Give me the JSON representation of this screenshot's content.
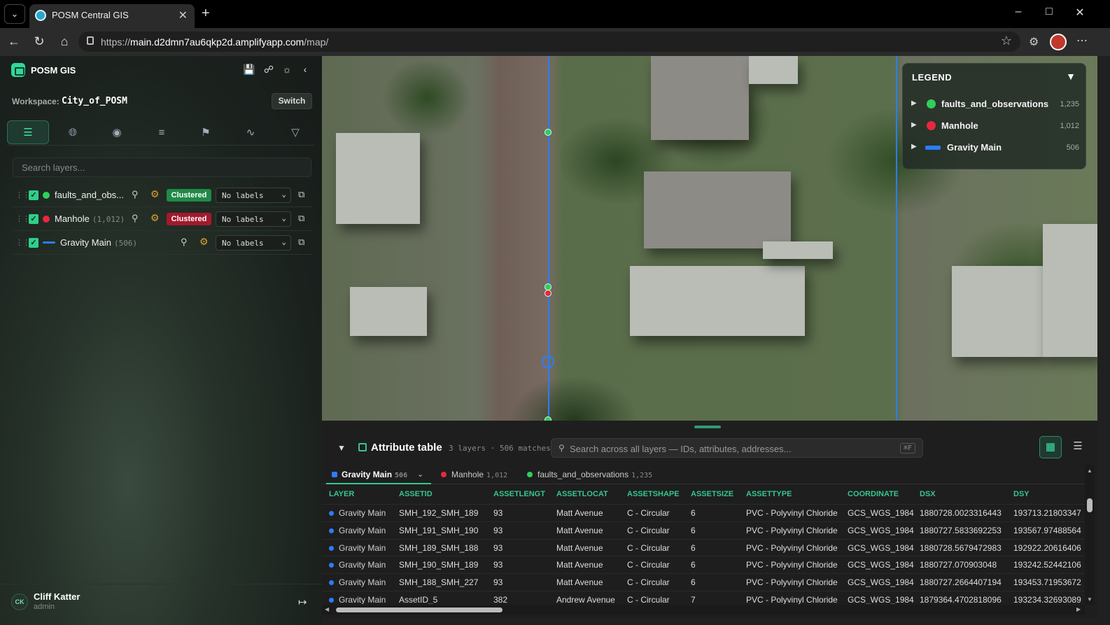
{
  "browser": {
    "tab_title": "POSM Central GIS",
    "url_prefix": "https://",
    "url_host": "main.d2dmn7au6qkp2d.amplifyapp.com",
    "url_path": "/map/"
  },
  "sidebar": {
    "brand": "POSM GIS",
    "workspace_label": "Workspace:",
    "workspace_value": "City_of_POSM",
    "switch_label": "Switch",
    "search_placeholder": "Search layers...",
    "layers": [
      {
        "name": "faults_and_obs...",
        "count": "",
        "color": "#2fcf5a",
        "clustered": "Clustered",
        "cluster_color": "#1f8a46",
        "labels": "No labels"
      },
      {
        "name": "Manhole",
        "count": "(1,012)",
        "color": "#e8283f",
        "clustered": "Clustered",
        "cluster_color": "#a3192d",
        "labels": "No labels"
      },
      {
        "name": "Gravity Main",
        "count": "(506)",
        "color": "#2a7dff",
        "clustered": "",
        "labels": "No labels"
      }
    ],
    "user_initials": "CK",
    "user_name": "Cliff Katter",
    "user_role": "admin"
  },
  "legend": {
    "title": "LEGEND",
    "items": [
      {
        "name": "faults_and_observations",
        "count": "1,235",
        "color": "#2fcf5a"
      },
      {
        "name": "Manhole",
        "count": "1,012",
        "color": "#e8283f"
      },
      {
        "name": "Gravity Main",
        "count": "506",
        "color": "#2a7dff"
      }
    ]
  },
  "attribute_table": {
    "title": "Attribute table",
    "meta": "3 layers · 506 matches",
    "search_placeholder": "Search across all layers — IDs, attributes, addresses...",
    "shortcut": "⌘F",
    "tabs": [
      {
        "name": "Gravity Main",
        "count": "506",
        "color": "#2a7dff"
      },
      {
        "name": "Manhole",
        "count": "1,012",
        "color": "#e8283f"
      },
      {
        "name": "faults_and_observations",
        "count": "1,235",
        "color": "#2fcf5a"
      }
    ],
    "columns": [
      "LAYER",
      "ASSETID",
      "ASSETLENGT",
      "ASSETLOCAT",
      "ASSETSHAPE",
      "ASSETSIZE",
      "ASSETTYPE",
      "COORDINATE",
      "DSX",
      "DSY"
    ],
    "rows": [
      [
        "Gravity Main",
        "SMH_192_SMH_189",
        "93",
        "Matt Avenue",
        "C - Circular",
        "6",
        "PVC - Polyvinyl Chloride",
        "GCS_WGS_1984",
        "1880728.0023316443",
        "193713.21803347"
      ],
      [
        "Gravity Main",
        "SMH_191_SMH_190",
        "93",
        "Matt Avenue",
        "C - Circular",
        "6",
        "PVC - Polyvinyl Chloride",
        "GCS_WGS_1984",
        "1880727.5833692253",
        "193567.97488564"
      ],
      [
        "Gravity Main",
        "SMH_189_SMH_188",
        "93",
        "Matt Avenue",
        "C - Circular",
        "6",
        "PVC - Polyvinyl Chloride",
        "GCS_WGS_1984",
        "1880728.5679472983",
        "192922.20616406"
      ],
      [
        "Gravity Main",
        "SMH_190_SMH_189",
        "93",
        "Matt Avenue",
        "C - Circular",
        "6",
        "PVC - Polyvinyl Chloride",
        "GCS_WGS_1984",
        "1880727.070903048",
        "193242.52442106"
      ],
      [
        "Gravity Main",
        "SMH_188_SMH_227",
        "93",
        "Matt Avenue",
        "C - Circular",
        "6",
        "PVC - Polyvinyl Chloride",
        "GCS_WGS_1984",
        "1880727.2664407194",
        "193453.71953672"
      ],
      [
        "Gravity Main",
        "AssetID_5",
        "382",
        "Andrew Avenue",
        "C - Circular",
        "7",
        "PVC - Polyvinyl Chloride",
        "GCS_WGS_1984",
        "1879364.4702818096",
        "193234.32693089"
      ]
    ]
  }
}
